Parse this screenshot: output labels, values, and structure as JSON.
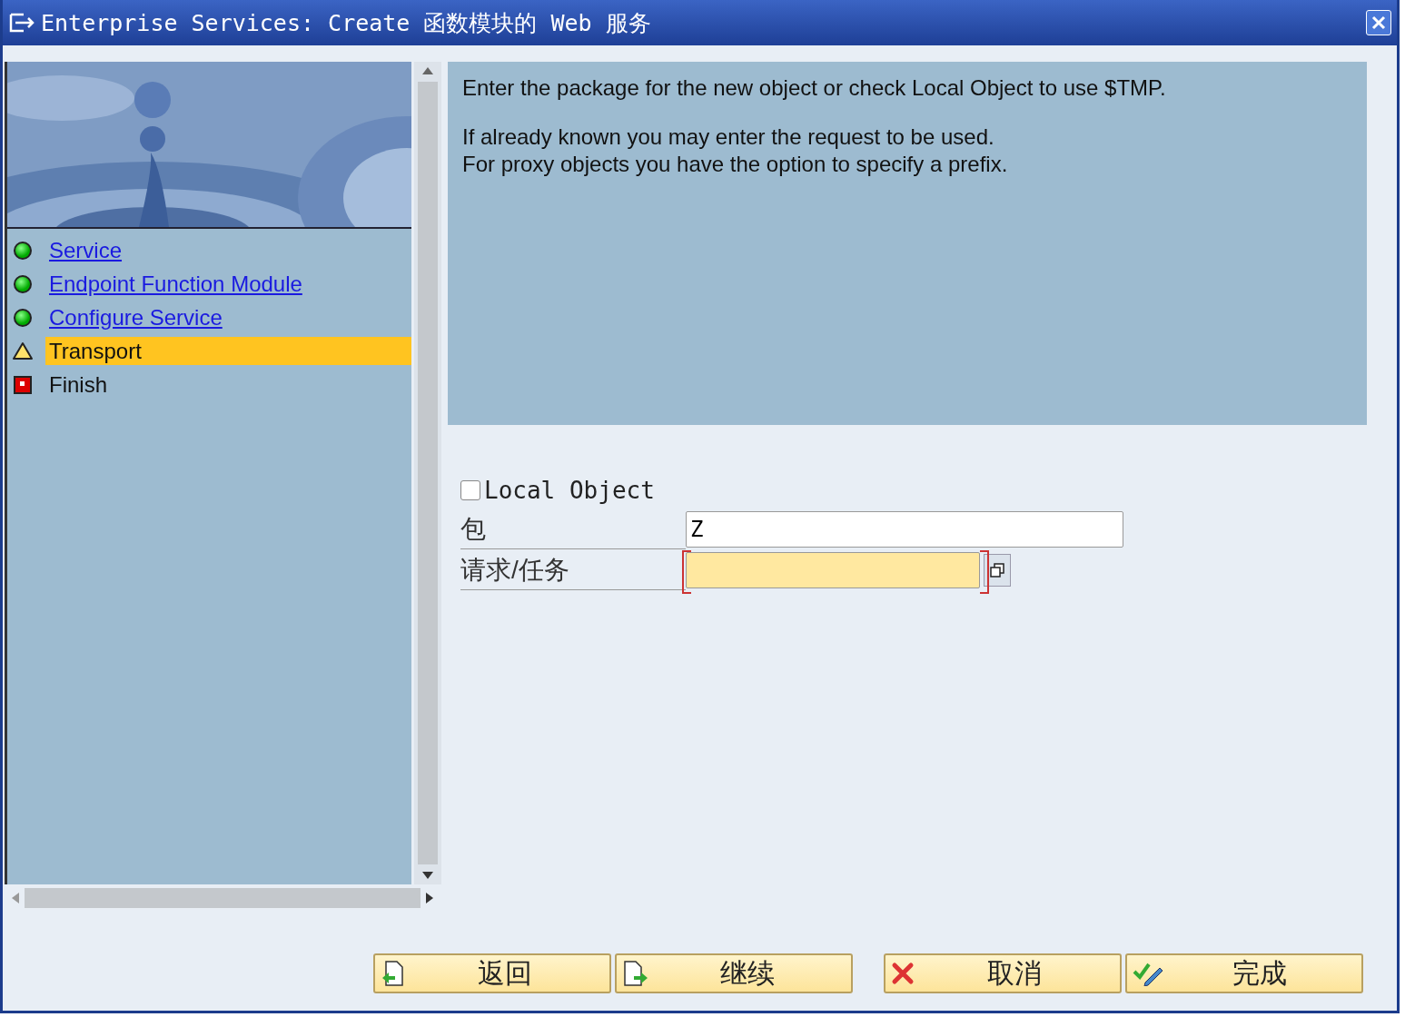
{
  "window": {
    "title": "Enterprise Services: Create 函数模块的 Web 服务"
  },
  "steps": [
    {
      "label": "Service",
      "kind": "done",
      "link": true,
      "selected": false
    },
    {
      "label": "Endpoint Function Module",
      "kind": "done",
      "link": true,
      "selected": false
    },
    {
      "label": "Configure Service",
      "kind": "done",
      "link": true,
      "selected": false
    },
    {
      "label": "Transport",
      "kind": "warning",
      "link": false,
      "selected": true
    },
    {
      "label": "Finish",
      "kind": "error",
      "link": false,
      "selected": false
    }
  ],
  "info": {
    "lines": [
      "Enter the package for the new object or check Local Object to use $TMP.",
      "If already known you may enter the request to be used.",
      "For proxy objects you have the option to specify a prefix."
    ]
  },
  "local_object": {
    "label": "Local Object",
    "checked": false
  },
  "fields": [
    {
      "label": "包",
      "value": "Z",
      "kind": "text"
    },
    {
      "label": "请求/任务",
      "kind": "lookup"
    }
  ],
  "buttons": [
    {
      "label": "返回",
      "kind": "back"
    },
    {
      "label": "继续",
      "kind": "continue"
    },
    {
      "label": "取消",
      "kind": "cancel"
    },
    {
      "label": "完成",
      "kind": "done"
    }
  ]
}
